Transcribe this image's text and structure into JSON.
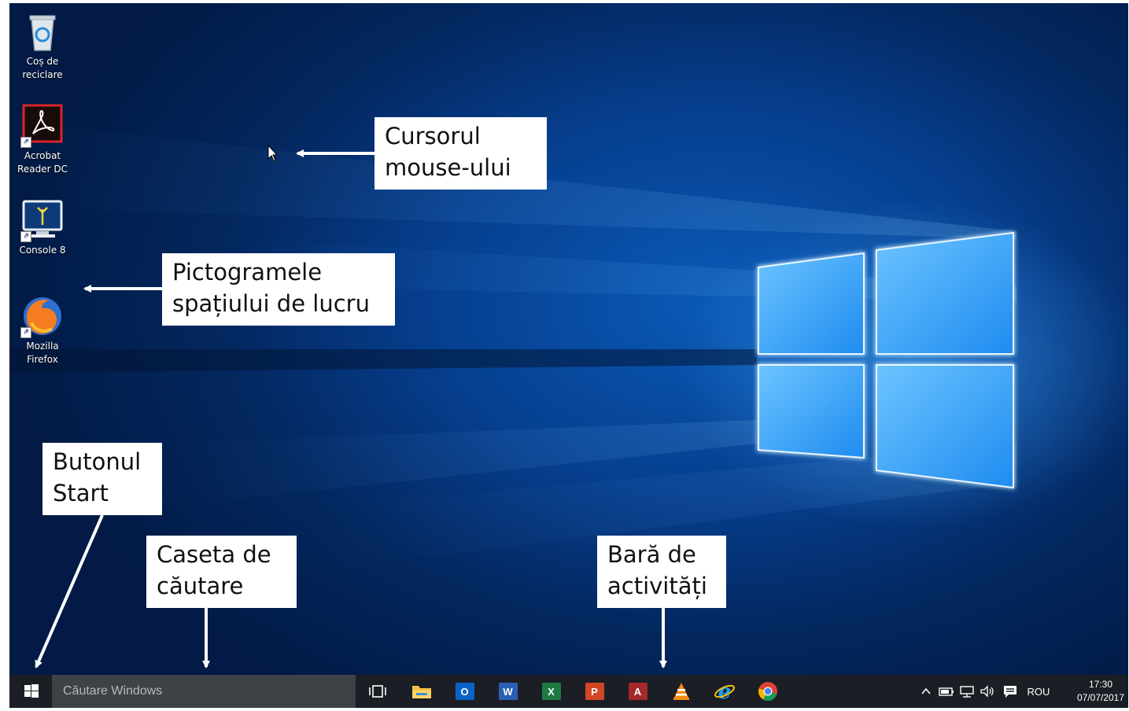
{
  "desktop": {
    "icons": [
      {
        "label": "Coș de\nreciclare",
        "icon": "recycle-bin-icon"
      },
      {
        "label": "Acrobat\nReader DC",
        "icon": "acrobat-reader-icon"
      },
      {
        "label": "Console 8",
        "icon": "console-icon"
      },
      {
        "label": "Mozilla\nFirefox",
        "icon": "firefox-icon"
      }
    ]
  },
  "callouts": {
    "cursor": "Cursorul\nmouse-ului",
    "desktop_icons": "Pictogramele\nspațiului de lucru",
    "start_button": "Butonul\nStart",
    "search_box": "Caseta de\ncăutare",
    "taskbar": "Bară de\nactivități"
  },
  "taskbar": {
    "search_placeholder": "Căutare Windows",
    "apps": [
      {
        "name": "task-view",
        "icon": "task-view-icon"
      },
      {
        "name": "file-explorer",
        "icon": "folder-icon"
      },
      {
        "name": "outlook",
        "icon": "outlook-icon",
        "letter": "O",
        "color": "#0a64c8"
      },
      {
        "name": "word",
        "icon": "word-icon",
        "letter": "W",
        "color": "#2b5fb5"
      },
      {
        "name": "excel",
        "icon": "excel-icon",
        "letter": "X",
        "color": "#1e7a43"
      },
      {
        "name": "powerpoint",
        "icon": "powerpoint-icon",
        "letter": "P",
        "color": "#d24625"
      },
      {
        "name": "access",
        "icon": "access-icon",
        "letter": "A",
        "color": "#a5282c"
      },
      {
        "name": "vlc",
        "icon": "vlc-icon"
      },
      {
        "name": "internet-explorer",
        "icon": "ie-icon"
      },
      {
        "name": "chrome",
        "icon": "chrome-icon"
      }
    ],
    "tray": {
      "language": "ROU",
      "time": "17:30",
      "date": "07/07/2017"
    }
  },
  "colors": {
    "taskbar_bg": "#1b1e25",
    "search_bg": "#3e4146",
    "desktop_blue": "#063f8f"
  }
}
